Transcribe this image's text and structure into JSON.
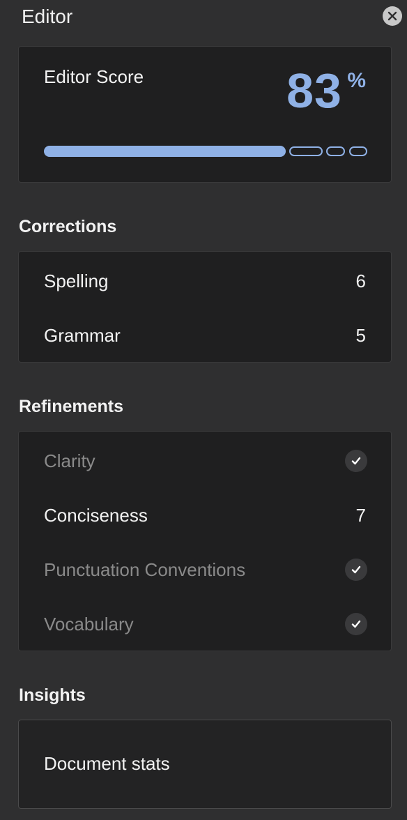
{
  "header": {
    "title": "Editor",
    "close_icon": "close-icon"
  },
  "score": {
    "label": "Editor Score",
    "value": "83",
    "unit": "%",
    "progress_fraction": 0.83,
    "accent_color": "#8fb1e6"
  },
  "corrections": {
    "title": "Corrections",
    "items": [
      {
        "label": "Spelling",
        "count": "6"
      },
      {
        "label": "Grammar",
        "count": "5"
      }
    ]
  },
  "refinements": {
    "title": "Refinements",
    "items": [
      {
        "label": "Clarity",
        "status": "done",
        "icon": "checkmark-icon"
      },
      {
        "label": "Conciseness",
        "count": "7"
      },
      {
        "label": "Punctuation Conventions",
        "status": "done",
        "icon": "checkmark-icon"
      },
      {
        "label": "Vocabulary",
        "status": "done",
        "icon": "checkmark-icon"
      }
    ]
  },
  "insights": {
    "title": "Insights",
    "items": [
      {
        "label": "Document stats"
      }
    ]
  }
}
